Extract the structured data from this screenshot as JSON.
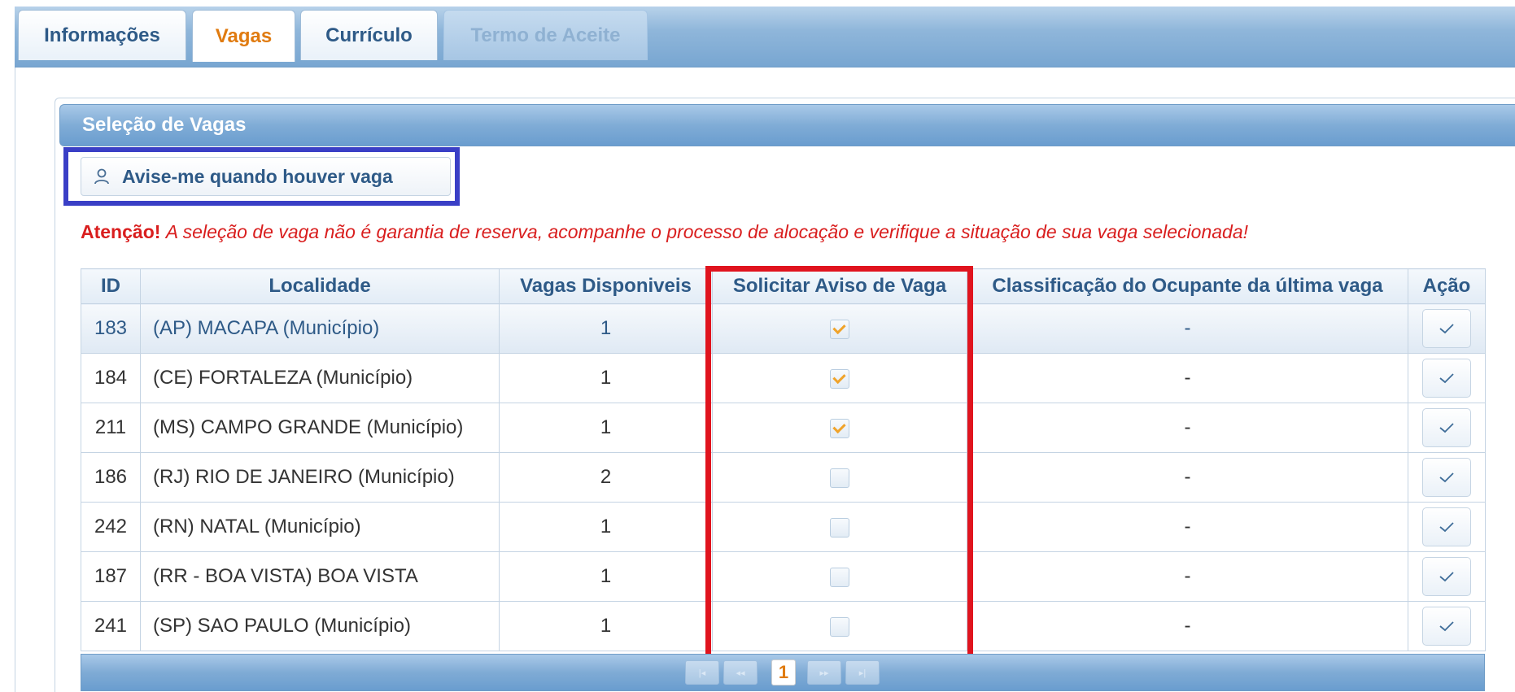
{
  "tabs": [
    {
      "label": "Informações",
      "state": "normal"
    },
    {
      "label": "Vagas",
      "state": "active"
    },
    {
      "label": "Currículo",
      "state": "normal"
    },
    {
      "label": "Termo de Aceite",
      "state": "disabled"
    }
  ],
  "panel": {
    "title": "Seleção de Vagas",
    "notify_button": "Avise-me quando houver vaga",
    "notify_icon": "user-icon"
  },
  "warning": {
    "strong": "Atenção!",
    "message": "A seleção de vaga não é garantia de reserva, acompanhe o processo de alocação e verifique a situação de sua vaga selecionada!"
  },
  "table": {
    "headers": {
      "id": "ID",
      "locality": "Localidade",
      "available": "Vagas Disponiveis",
      "request_notice": "Solicitar Aviso de Vaga",
      "classification": "Classificação do Ocupante da última vaga",
      "action": "Ação"
    },
    "rows": [
      {
        "id": "183",
        "locality": "(AP) MACAPA (Município)",
        "available": "1",
        "notice": true,
        "classification": "-"
      },
      {
        "id": "184",
        "locality": "(CE) FORTALEZA (Município)",
        "available": "1",
        "notice": true,
        "classification": "-"
      },
      {
        "id": "211",
        "locality": "(MS) CAMPO GRANDE (Município)",
        "available": "1",
        "notice": true,
        "classification": "-"
      },
      {
        "id": "186",
        "locality": "(RJ) RIO DE JANEIRO (Município)",
        "available": "2",
        "notice": false,
        "classification": "-"
      },
      {
        "id": "242",
        "locality": "(RN) NATAL (Município)",
        "available": "1",
        "notice": false,
        "classification": "-"
      },
      {
        "id": "187",
        "locality": "(RR - BOA VISTA) BOA VISTA",
        "available": "1",
        "notice": false,
        "classification": "-"
      },
      {
        "id": "241",
        "locality": "(SP) SAO PAULO (Município)",
        "available": "1",
        "notice": false,
        "classification": "-"
      }
    ]
  },
  "pager": {
    "current_page": "1",
    "first_icon": "first-page-icon",
    "prev_icon": "prev-page-icon",
    "next_icon": "next-page-icon",
    "last_icon": "last-page-icon"
  },
  "colors": {
    "accent": "#e07b10",
    "header_text": "#2e5a87",
    "warning": "#d91e1e",
    "highlight_blue": "#3a3fc6",
    "highlight_red": "#e0141e",
    "checkbox_check": "#f0a32a"
  }
}
